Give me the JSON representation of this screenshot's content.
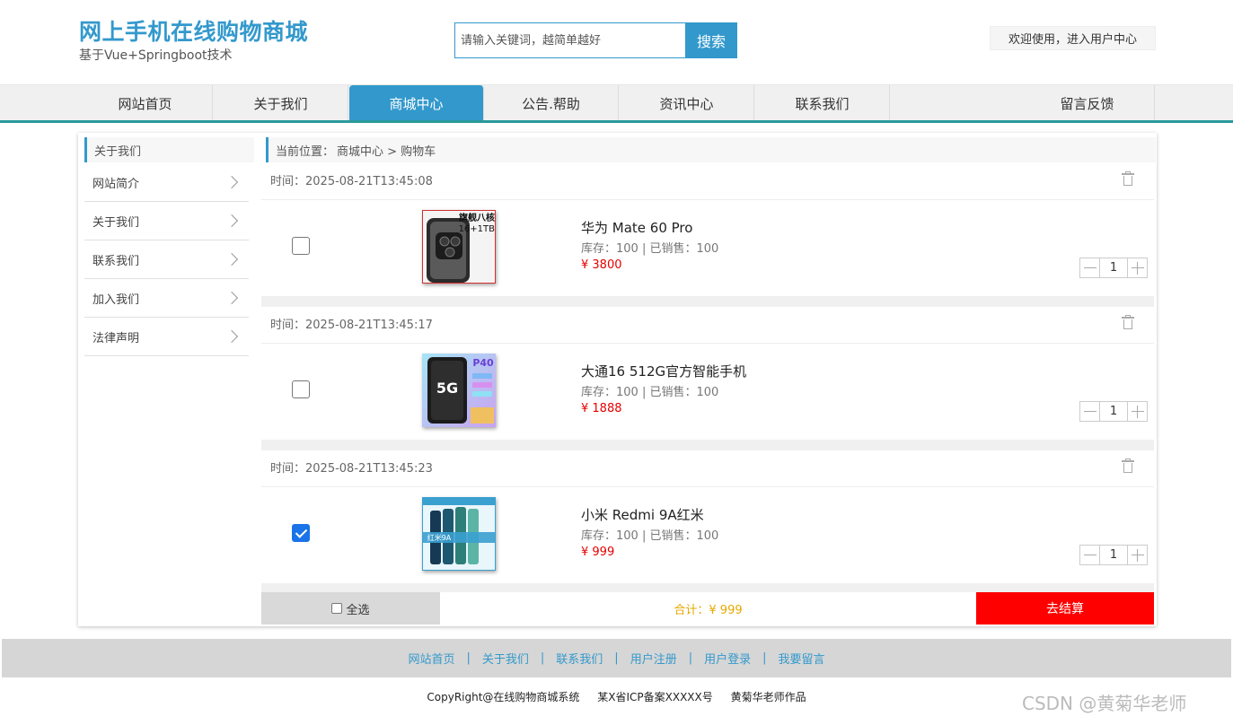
{
  "header": {
    "title": "网上手机在线购物商城",
    "subtitle": "基于Vue+Springboot技术",
    "search_placeholder": "请输入关键词，越简单越好",
    "search_button": "搜索",
    "user_center": "欢迎使用，进入用户中心"
  },
  "nav": {
    "items": [
      "网站首页",
      "关于我们",
      "商城中心",
      "公告.帮助",
      "资讯中心",
      "联系我们",
      "留言反馈"
    ],
    "active": "商城中心"
  },
  "sidebar": {
    "heading": "关于我们",
    "items": [
      "网站简介",
      "关于我们",
      "联系我们",
      "加入我们",
      "法律声明"
    ]
  },
  "breadcrumb": {
    "prefix": "当前位置：",
    "path": "商城中心 > 购物车"
  },
  "cart": {
    "items": [
      {
        "time": "时间：2025-08-21T13:45:08",
        "name": "华为 Mate 60 Pro",
        "stock": "库存：100 | 已销售：100",
        "price": "¥ 3800",
        "quantity": "1",
        "checked": false,
        "thumb_text": "旗舰八核",
        "thumb_text2": "16+1TB"
      },
      {
        "time": "时间：2025-08-21T13:45:17",
        "name": "大通16 512G官方智能手机",
        "stock": "库存：100 | 已销售：100",
        "price": "¥ 1888",
        "quantity": "1",
        "checked": false,
        "thumb_text": "P40",
        "thumb_text2": "5G"
      },
      {
        "time": "时间：2025-08-21T13:45:23",
        "name": "小米 Redmi 9A红米",
        "stock": "库存：100 | 已销售：100",
        "price": "¥ 999",
        "quantity": "1",
        "checked": true,
        "thumb_text": "红米9A",
        "thumb_text2": ""
      }
    ],
    "select_all": "全选",
    "total": "合计：¥ 999",
    "checkout": "去结算"
  },
  "footer": {
    "links": [
      "网站首页",
      "关于我们",
      "联系我们",
      "用户注册",
      "用户登录",
      "我要留言"
    ],
    "copyright": "CopyRight@在线购物商城系统",
    "icp": "某X省ICP备案XXXXX号",
    "author": "黄菊华老师作品",
    "watermark": "CSDN @黄菊华老师"
  },
  "colors": {
    "brand": "#3399cc",
    "accent_line": "#2a9a9a",
    "price": "#e60000",
    "checkout": "#ff0000",
    "total": "#e6a800"
  }
}
